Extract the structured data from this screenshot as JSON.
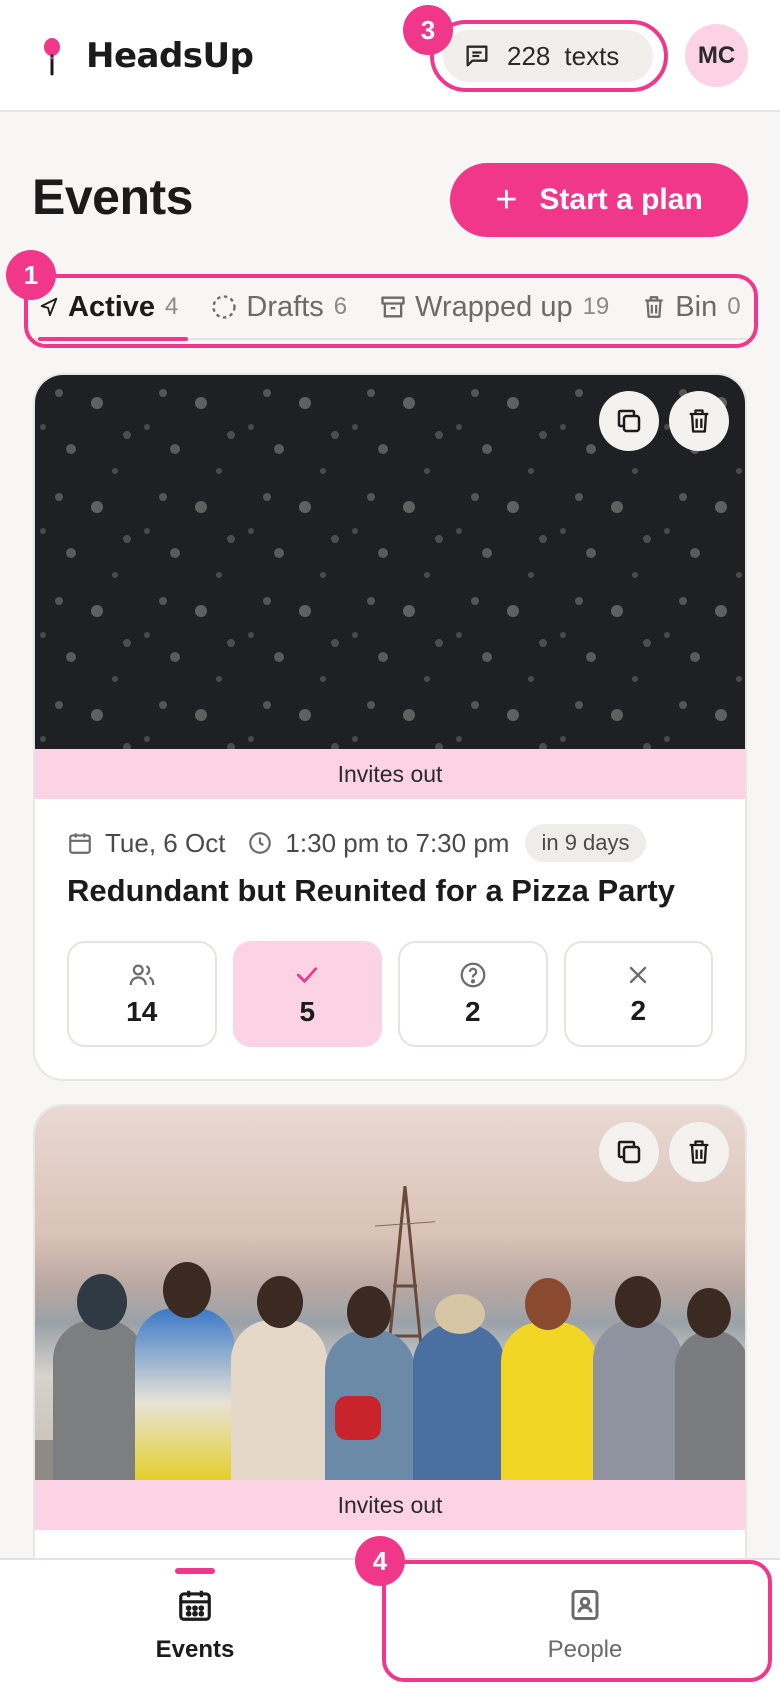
{
  "app": {
    "name": "HeadsUp"
  },
  "header": {
    "texts_count": "228",
    "texts_label": "texts",
    "avatar_initials": "MC"
  },
  "annotations": {
    "tabs": "1",
    "texts": "3",
    "people": "4"
  },
  "page": {
    "title": "Events",
    "start_plan_label": "Start a plan"
  },
  "tabs": [
    {
      "label": "Active",
      "count": "4",
      "icon": "send-icon",
      "selected": true
    },
    {
      "label": "Drafts",
      "count": "6",
      "icon": "dashed-circle-icon",
      "selected": false
    },
    {
      "label": "Wrapped up",
      "count": "19",
      "icon": "archive-icon",
      "selected": false
    },
    {
      "label": "Bin",
      "count": "0",
      "icon": "trash-icon",
      "selected": false
    }
  ],
  "events": [
    {
      "status": "Invites out",
      "date": "Tue, 6 Oct",
      "time": "1:30 pm to 7:30 pm",
      "relative": "in 9 days",
      "title": "Redundant but Reunited for a Pizza Party",
      "stats": {
        "invited": "14",
        "going": "5",
        "maybe": "2",
        "declined": "2"
      }
    },
    {
      "status": "Invites out"
    }
  ],
  "bottom_nav": {
    "events_label": "Events",
    "people_label": "People"
  },
  "colors": {
    "accent": "#f0378a",
    "accent_soft": "#fcd3e5",
    "dark_card": "#1e2024"
  }
}
